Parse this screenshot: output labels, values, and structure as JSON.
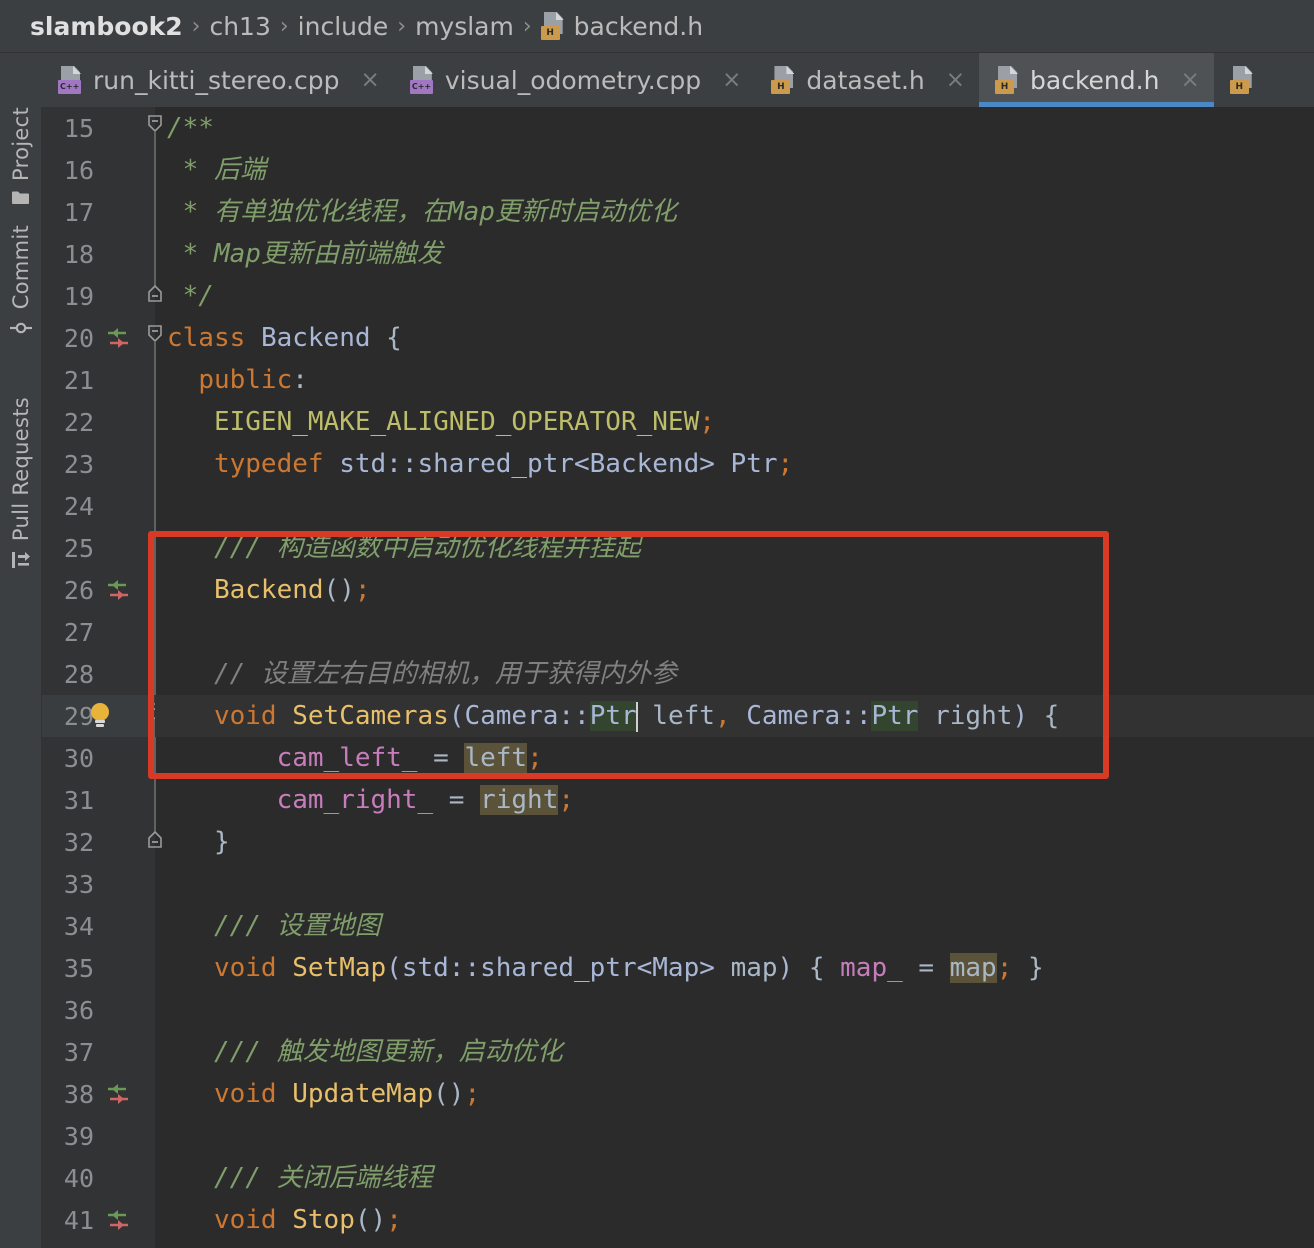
{
  "window": {
    "theme": "darcula",
    "accent_blue": "#4a88c7",
    "annotation_color": "#d93a26"
  },
  "breadcrumb": {
    "items": [
      {
        "label": "slambook2",
        "icon": null,
        "bold": true
      },
      {
        "label": "ch13",
        "icon": null,
        "bold": false
      },
      {
        "label": "include",
        "icon": null,
        "bold": false
      },
      {
        "label": "myslam",
        "icon": null,
        "bold": false
      },
      {
        "label": "backend.h",
        "icon": "h-file-icon",
        "bold": false
      }
    ],
    "separator": "›"
  },
  "tabs": [
    {
      "label": "run_kitti_stereo.cpp",
      "icon": "cpp-file-icon",
      "badge": "C++",
      "active": false,
      "close": "×"
    },
    {
      "label": "visual_odometry.cpp",
      "icon": "cpp-file-icon",
      "badge": "C++",
      "active": false,
      "close": "×"
    },
    {
      "label": "dataset.h",
      "icon": "h-file-icon",
      "badge": "H",
      "active": false,
      "close": "×"
    },
    {
      "label": "backend.h",
      "icon": "h-file-icon",
      "badge": "H",
      "active": true,
      "close": "×"
    },
    {
      "label": "",
      "icon": "h-file-icon",
      "badge": "H",
      "active": false,
      "close": ""
    }
  ],
  "tool_window_bar": {
    "items": [
      {
        "label": "Project",
        "icon": "folder-icon"
      },
      {
        "label": "Commit",
        "icon": "commit-icon"
      },
      {
        "label": "Pull Requests",
        "icon": "pull-request-icon"
      }
    ]
  },
  "editor": {
    "file": "backend.h",
    "language": "C++",
    "current_line": 29,
    "caret_line": 29,
    "lines": [
      {
        "num": "15",
        "marker": null,
        "fold": "start-collapsed"
      },
      {
        "num": "16",
        "marker": null,
        "fold": "body"
      },
      {
        "num": "17",
        "marker": null,
        "fold": "body"
      },
      {
        "num": "18",
        "marker": null,
        "fold": "body"
      },
      {
        "num": "19",
        "marker": null,
        "fold": "end"
      },
      {
        "num": "20",
        "marker": "override-arrows-icon",
        "fold": "start-collapsed"
      },
      {
        "num": "21",
        "marker": null,
        "fold": null
      },
      {
        "num": "22",
        "marker": null,
        "fold": null
      },
      {
        "num": "23",
        "marker": null,
        "fold": null
      },
      {
        "num": "24",
        "marker": null,
        "fold": null
      },
      {
        "num": "25",
        "marker": null,
        "fold": null
      },
      {
        "num": "26",
        "marker": "override-arrows-icon",
        "fold": null
      },
      {
        "num": "27",
        "marker": null,
        "fold": null
      },
      {
        "num": "28",
        "marker": null,
        "fold": null
      },
      {
        "num": "29",
        "marker": "lightbulb-icon",
        "fold": "start-collapsed"
      },
      {
        "num": "30",
        "marker": null,
        "fold": "body"
      },
      {
        "num": "31",
        "marker": null,
        "fold": "body"
      },
      {
        "num": "32",
        "marker": null,
        "fold": "end"
      },
      {
        "num": "33",
        "marker": null,
        "fold": null
      },
      {
        "num": "34",
        "marker": null,
        "fold": null
      },
      {
        "num": "35",
        "marker": null,
        "fold": null
      },
      {
        "num": "36",
        "marker": null,
        "fold": null
      },
      {
        "num": "37",
        "marker": null,
        "fold": null
      },
      {
        "num": "38",
        "marker": "override-arrows-icon",
        "fold": null
      },
      {
        "num": "39",
        "marker": null,
        "fold": null
      },
      {
        "num": "40",
        "marker": null,
        "fold": null
      },
      {
        "num": "41",
        "marker": "override-arrows-icon",
        "fold": null
      }
    ],
    "code_text": {
      "l15": "/**",
      "l16": " * 后端",
      "l17": " * 有单独优化线程，在Map更新时启动优化",
      "l18": " * Map更新由前端触发",
      "l19": " */",
      "l20": "class Backend {",
      "l21": "  public:",
      "l22": "   EIGEN_MAKE_ALIGNED_OPERATOR_NEW;",
      "l23": "   typedef std::shared_ptr<Backend> Ptr;",
      "l24": "",
      "l25": "   /// 构造函数中启动优化线程并挂起",
      "l26": "   Backend();",
      "l27": "",
      "l28": "   // 设置左右目的相机，用于获得内外参",
      "l29": "   void SetCameras(Camera::Ptr left, Camera::Ptr right) {",
      "l30": "       cam_left_ = left;",
      "l31": "       cam_right_ = right;",
      "l32": "   }",
      "l33": "",
      "l34": "   /// 设置地图",
      "l35": "   void SetMap(std::shared_ptr<Map> map) { map_ = map; }",
      "l36": "",
      "l37": "   /// 触发地图更新，启动优化",
      "l38": "   void UpdateMap();",
      "l39": "",
      "l40": "   /// 关闭后端线程",
      "l41": "   void Stop();"
    },
    "tokens": {
      "comment_block_open": "/**",
      "comment_star": " * ",
      "comment_cn_1": "后端",
      "comment_cn_2": "有单独优化线程，在Map更新时启动优化",
      "comment_cn_3": "Map更新由前端触发",
      "comment_block_close": " */",
      "kw_class": "class",
      "name_backend": "Backend",
      "brace_open": " {",
      "kw_public": "public",
      "colon": ":",
      "macro_eigen": "EIGEN_MAKE_ALIGNED_OPERATOR_NEW",
      "semi": ";",
      "kw_typedef": "typedef",
      "type_shared_ptr_backend": " std::shared_ptr<Backend> ",
      "name_ptr": "Ptr",
      "doc_cn_ctor": "/// 构造函数中启动优化线程并挂起",
      "ctor_backend": "Backend",
      "parens": "()",
      "comment_cn_setcameras": "// 设置左右目的相机，用于获得内外参",
      "kw_void": "void",
      "fn_setcameras": "SetCameras",
      "paren_open": "(",
      "type_camera": "Camera::",
      "hl_ptr_1": "Ptr",
      "param_left": " left",
      "comma": ", ",
      "type_camera2": "Camera::",
      "hl_ptr_2": "Ptr",
      "param_right": " right",
      "paren_close": ")",
      "field_cam_left": "cam_left_",
      "eq": " = ",
      "hl_left": "left",
      "field_cam_right": "cam_right_",
      "hl_right": "right",
      "brace_close": "}",
      "doc_cn_setmap": "/// 设置地图",
      "fn_setmap": "SetMap",
      "type_shared_ptr_map": "std::shared_ptr<Map> ",
      "param_map": "map",
      "field_map_": "map_",
      "hl_map": "map",
      "doc_cn_updatemap": "/// 触发地图更新，启动优化",
      "fn_updatemap": "UpdateMap",
      "doc_cn_stop": "/// 关闭后端线程",
      "fn_stop": "Stop"
    }
  },
  "annotation": {
    "type": "red-rectangle-highlight",
    "covers_lines": "28-32",
    "color": "#d93a26"
  }
}
